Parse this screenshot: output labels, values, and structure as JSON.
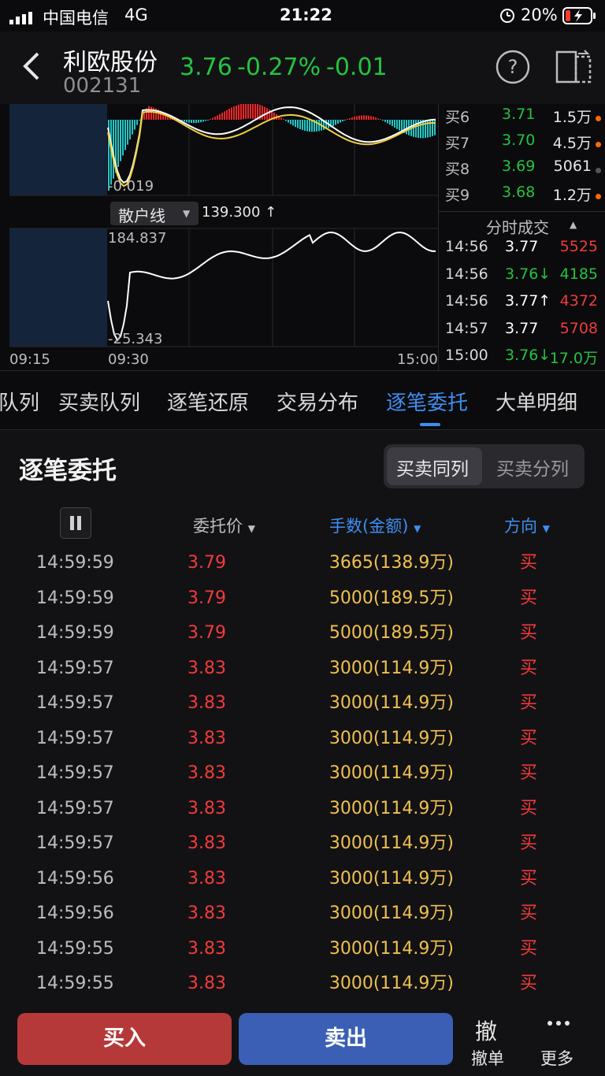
{
  "status": {
    "carrier": "中国电信",
    "network": "4G",
    "time": "21:22",
    "battery": "20%"
  },
  "stock": {
    "name": "利欧股份",
    "code": "002131",
    "price": "3.76",
    "pct": "-0.27%",
    "chg": "-0.01"
  },
  "chart": {
    "top_label": "-0.019",
    "indicator": "散户线",
    "indicator_value": "139.300 ↑",
    "y_top": "184.837",
    "y_bottom": "-25.343",
    "x_labels": [
      "09:15",
      "09:30",
      "15:00"
    ],
    "colors": {
      "up": "#e8262a",
      "down": "#26c6c6",
      "line": "#ffffff",
      "avg": "#f0d040"
    }
  },
  "book": [
    {
      "label": "买6",
      "price": "3.71",
      "vol": "1.5万",
      "dot": "orange"
    },
    {
      "label": "买7",
      "price": "3.70",
      "vol": "4.5万",
      "dot": "orange"
    },
    {
      "label": "买8",
      "price": "3.69",
      "vol": "5061",
      "dot": "gray"
    },
    {
      "label": "买9",
      "price": "3.68",
      "vol": "1.2万",
      "dot": "orange"
    }
  ],
  "ticks": {
    "header": "分时成交",
    "rows": [
      {
        "time": "14:56",
        "price": "3.77",
        "vol": "5525",
        "pcolor": "#ffffff",
        "vcolor": "#f23b3b"
      },
      {
        "time": "14:56",
        "price": "3.76↓",
        "vol": "4185",
        "pcolor": "#25c33f",
        "vcolor": "#25c33f"
      },
      {
        "time": "14:56",
        "price": "3.77↑",
        "vol": "4372",
        "pcolor": "#ffffff",
        "vcolor": "#f23b3b"
      },
      {
        "time": "14:57",
        "price": "3.77",
        "vol": "5708",
        "pcolor": "#ffffff",
        "vcolor": "#f23b3b"
      },
      {
        "time": "15:00",
        "price": "3.76↓",
        "vol": "17.0万",
        "pcolor": "#25c33f",
        "vcolor": "#25c33f"
      }
    ]
  },
  "tabs": [
    "队列",
    "买卖队列",
    "逐笔还原",
    "交易分布",
    "逐笔委托",
    "大单明细"
  ],
  "section": {
    "title": "逐笔委托",
    "seg_on": "买卖同列",
    "seg_off": "买卖分列",
    "col_price": "委托价",
    "col_vol": "手数(金额)",
    "col_dir": "方向"
  },
  "orders": [
    {
      "time": "14:59:59",
      "price": "3.79",
      "vol": "3665(138.9万)",
      "dir": "买"
    },
    {
      "time": "14:59:59",
      "price": "3.79",
      "vol": "5000(189.5万)",
      "dir": "买"
    },
    {
      "time": "14:59:59",
      "price": "3.79",
      "vol": "5000(189.5万)",
      "dir": "买"
    },
    {
      "time": "14:59:57",
      "price": "3.83",
      "vol": "3000(114.9万)",
      "dir": "买"
    },
    {
      "time": "14:59:57",
      "price": "3.83",
      "vol": "3000(114.9万)",
      "dir": "买"
    },
    {
      "time": "14:59:57",
      "price": "3.83",
      "vol": "3000(114.9万)",
      "dir": "买"
    },
    {
      "time": "14:59:57",
      "price": "3.83",
      "vol": "3000(114.9万)",
      "dir": "买"
    },
    {
      "time": "14:59:57",
      "price": "3.83",
      "vol": "3000(114.9万)",
      "dir": "买"
    },
    {
      "time": "14:59:57",
      "price": "3.83",
      "vol": "3000(114.9万)",
      "dir": "买"
    },
    {
      "time": "14:59:56",
      "price": "3.83",
      "vol": "3000(114.9万)",
      "dir": "买"
    },
    {
      "time": "14:59:56",
      "price": "3.83",
      "vol": "3000(114.9万)",
      "dir": "买"
    },
    {
      "time": "14:59:55",
      "price": "3.83",
      "vol": "3000(114.9万)",
      "dir": "买"
    },
    {
      "time": "14:59:55",
      "price": "3.83",
      "vol": "3000(114.9万)",
      "dir": "买"
    }
  ],
  "bottom": {
    "buy": "买入",
    "sell": "卖出",
    "cancel_icon": "撤",
    "cancel": "撤单",
    "more": "更多"
  }
}
